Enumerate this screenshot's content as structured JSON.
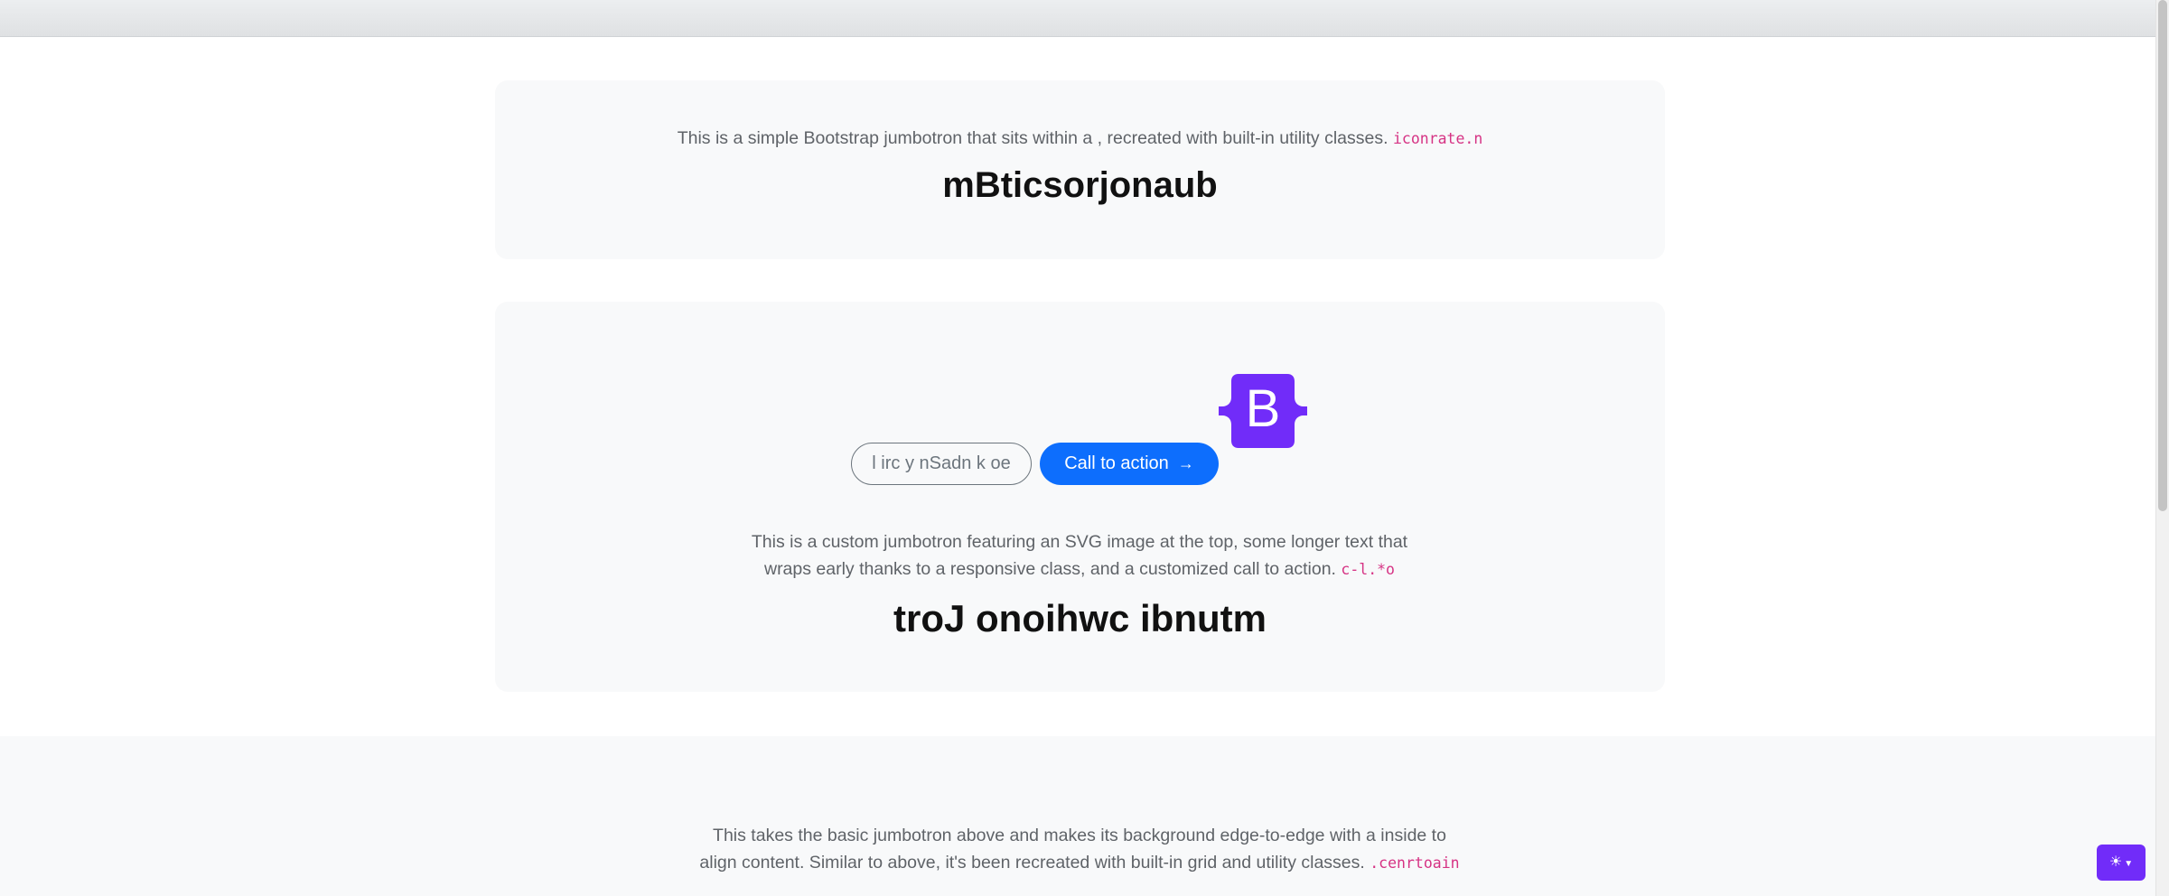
{
  "jumbotron_basic": {
    "lead_text": "This is a simple Bootstrap jumbotron that sits within a , recreated with built-in utility classes.",
    "code": "iconrate.n",
    "title": "mBticsorjonaub"
  },
  "jumbotron_custom": {
    "logo_letter": "B",
    "secondary_button": "l irc y nSadn k oe",
    "primary_button": "Call to action",
    "primary_button_icon": "arrow-right-icon",
    "lead_text": "This is a custom jumbotron featuring an SVG image at the top, some longer text that wraps early thanks to a responsive class, and a customized call to action.",
    "code": "c-l.*o",
    "title": "troJ onoihwc ibnutm"
  },
  "jumbotron_fullwidth": {
    "lead_text": "This takes the basic jumbotron above and makes its background edge-to-edge with a inside to align content. Similar to above, it's been recreated with built-in grid and utility classes.",
    "code": ".cenrtoain"
  },
  "theme_toggle": {
    "icon": "sun-icon",
    "caret_icon": "caret-down-icon"
  },
  "colors": {
    "card_bg": "#f8f9fa",
    "primary": "#0d6efd",
    "brand_purple": "#712cf9",
    "code_pink": "#d63384"
  }
}
